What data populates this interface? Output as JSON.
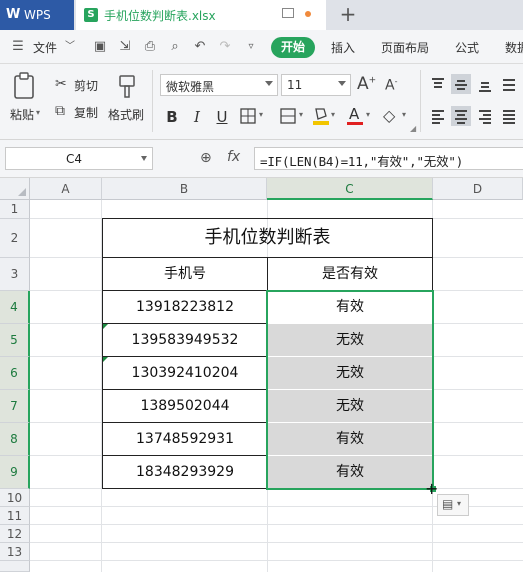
{
  "titlebar": {
    "app_name": "WPS",
    "file_name": "手机位数判断表.xlsx",
    "new_tab": "+"
  },
  "menu": {
    "file_label": "文件",
    "tabs": [
      "开始",
      "插入",
      "页面布局",
      "公式",
      "数据"
    ]
  },
  "ribbon": {
    "paste_label": "粘贴",
    "cut_label": "剪切",
    "copy_label": "复制",
    "format_painter_label": "格式刷",
    "font_name": "微软雅黑",
    "font_size": "11",
    "bold": "B",
    "italic": "I",
    "underline": "U"
  },
  "formula_bar": {
    "cell_ref": "C4",
    "fx_label": "fx",
    "formula": "=IF(LEN(B4)=11,\"有效\",\"无效\")"
  },
  "sheet": {
    "columns": [
      "A",
      "B",
      "C",
      "D"
    ],
    "selected_column": "C",
    "rows": [
      "1",
      "2",
      "3",
      "4",
      "5",
      "6",
      "7",
      "8",
      "9",
      "10",
      "11",
      "12",
      "13"
    ],
    "table_title": "手机位数判断表",
    "header_phone": "手机号",
    "header_valid": "是否有效",
    "records": [
      {
        "phone": "13918223812",
        "valid": "有效"
      },
      {
        "phone": "139583949532",
        "valid": "无效"
      },
      {
        "phone": "130392410204",
        "valid": "无效"
      },
      {
        "phone": "1389502044",
        "valid": "无效"
      },
      {
        "phone": "13748592931",
        "valid": "有效"
      },
      {
        "phone": "18348293929",
        "valid": "有效"
      }
    ]
  },
  "colors": {
    "accent_green": "#27a45d",
    "wps_blue": "#2d5aa6",
    "selection_fill": "#d9d9d9"
  }
}
